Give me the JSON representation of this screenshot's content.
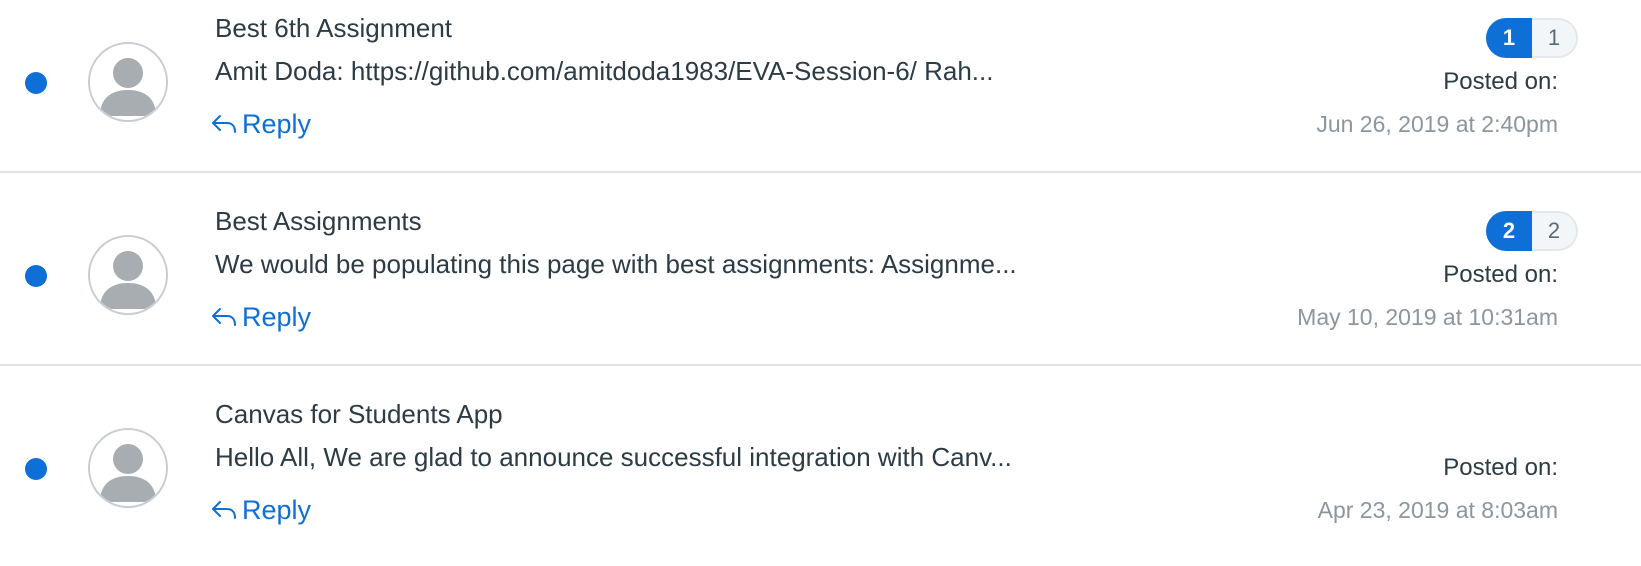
{
  "colors": {
    "accent": "#0e6fd6",
    "text": "#2d3b45",
    "muted": "#8b969e",
    "badge_total_text": "#5a6a75"
  },
  "reply_icon": "reply-arrow-icon",
  "avatar_icon": "default-avatar-icon",
  "discussions": [
    {
      "title": "Best 6th Assignment",
      "excerpt": "Amit Doda:  https://github.com/amitdoda1983/EVA-Session-6/  Rah...",
      "reply_label": "Reply",
      "unread_count": "1",
      "total_count": "1",
      "posted_label": "Posted on:",
      "posted_date": "Jun 26, 2019 at 2:40pm",
      "unread": true
    },
    {
      "title": "Best Assignments",
      "excerpt": "We would be populating this page with best assignments:  Assignme...",
      "reply_label": "Reply",
      "unread_count": "2",
      "total_count": "2",
      "posted_label": "Posted on:",
      "posted_date": "May 10, 2019 at 10:31am",
      "unread": true
    },
    {
      "title": "Canvas for Students App",
      "excerpt": "Hello All,  We are glad to announce successful integration with Canv...",
      "reply_label": "Reply",
      "posted_label": "Posted on:",
      "posted_date": "Apr 23, 2019 at 8:03am",
      "unread": true
    }
  ]
}
